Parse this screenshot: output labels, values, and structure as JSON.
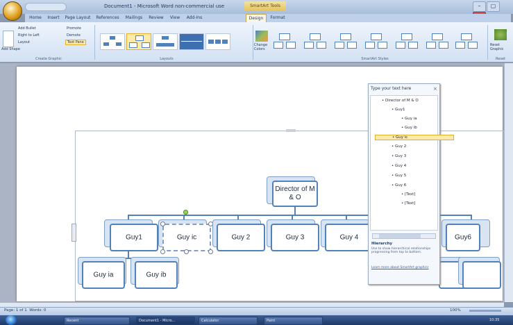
{
  "window": {
    "title": "Document1 - Microsoft Word non-commercial use",
    "context_tab": "SmartArt Tools",
    "controls": [
      "–",
      "▢",
      "✕"
    ]
  },
  "tabs": [
    "Home",
    "Insert",
    "Page Layout",
    "References",
    "Mailings",
    "Review",
    "View",
    "Add-Ins",
    "Design",
    "Format"
  ],
  "active_tab": "Design",
  "ribbon": {
    "create_graphic": {
      "label": "Create Graphic",
      "add_shape": "Add Shape",
      "add_bullet": "Add Bullet",
      "right_to_left": "Right to Left",
      "layout": "Layout",
      "promote": "Promote",
      "demote": "Demote",
      "text_pane": "Text Pane"
    },
    "layouts_label": "Layouts",
    "change_colors": "Change Colors",
    "smartart_styles_label": "SmartArt Styles",
    "reset": "Reset Graphic",
    "reset_label": "Reset"
  },
  "org_chart": {
    "root": "Director of M & O",
    "row1": [
      "Guy1",
      "Guy ic",
      "Guy 2",
      "Guy 3",
      "Guy 4",
      "Guy 5",
      "Guy6"
    ],
    "row2": [
      "Guy ia",
      "Guy ib"
    ]
  },
  "text_pane": {
    "title": "Type your text here",
    "close": "×",
    "items": [
      {
        "text": "Director of M & O",
        "level": 0
      },
      {
        "text": "Guy1",
        "level": 1
      },
      {
        "text": "Guy ia",
        "level": 2
      },
      {
        "text": "Guy ib",
        "level": 2
      },
      {
        "text": "Guy ic",
        "level": 1
      },
      {
        "text": "Guy 2",
        "level": 1
      },
      {
        "text": "Guy 3",
        "level": 1
      },
      {
        "text": "Guy 4",
        "level": 1
      },
      {
        "text": "Guy 5",
        "level": 1
      },
      {
        "text": "Guy 6",
        "level": 1
      },
      {
        "text": "[Text]",
        "level": 2
      },
      {
        "text": "[Text]",
        "level": 2
      }
    ],
    "selected_index": 4,
    "info_title": "Hierarchy",
    "info_text": "Use to show hierarchical relationships progressing from top to bottom.",
    "learn_more": "Learn more about SmartArt graphics"
  },
  "status": {
    "page": "Page: 1 of 1",
    "words": "Words: 0",
    "zoom": "100%"
  },
  "taskbar": {
    "buttons": [
      "Recent",
      "Document1 - Micro...",
      "Calculator",
      "Paint"
    ],
    "time": "10:35"
  }
}
